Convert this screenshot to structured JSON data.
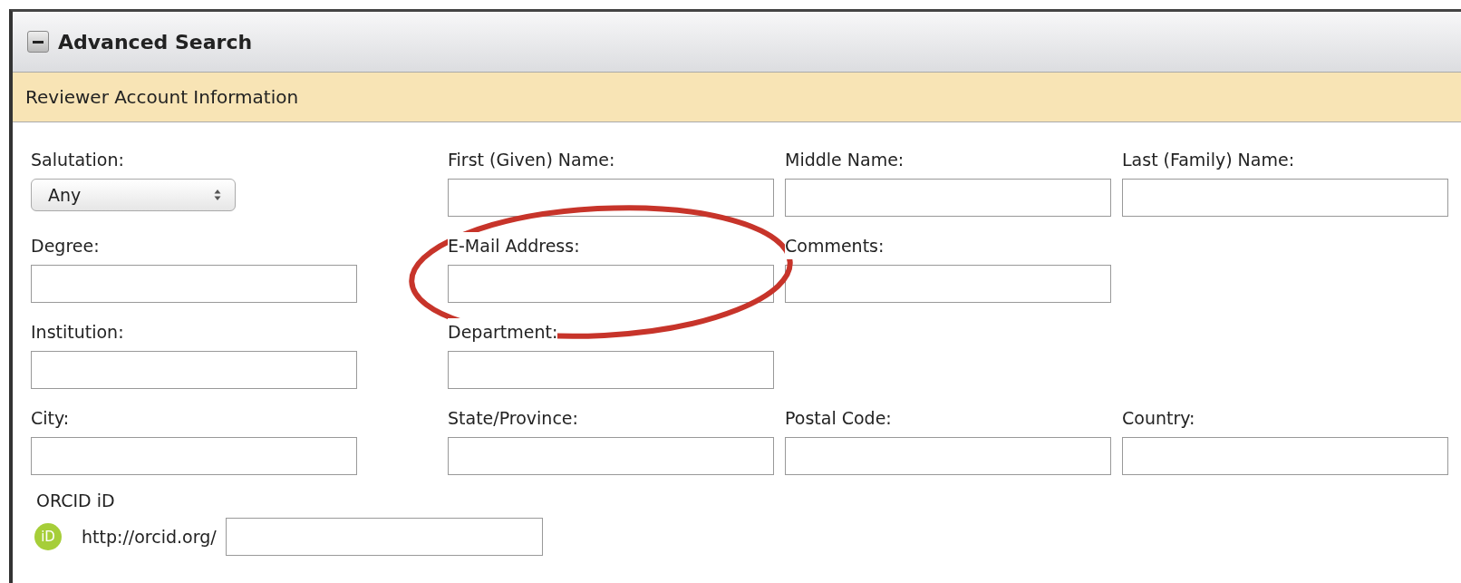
{
  "panel": {
    "title": "Advanced Search",
    "expanded": true
  },
  "section": {
    "title": "Reviewer Account Information"
  },
  "rows": [
    [
      {
        "kind": "select",
        "label": "Salutation:",
        "value": "Any"
      },
      {
        "kind": "text",
        "label": "First (Given) Name:"
      },
      {
        "kind": "text",
        "label": "Middle Name:"
      },
      {
        "kind": "text",
        "label": "Last (Family) Name:"
      }
    ],
    [
      {
        "kind": "text",
        "label": "Degree:"
      },
      {
        "kind": "text",
        "label": "E-Mail Address:"
      },
      {
        "kind": "text",
        "label": "Comments:"
      }
    ],
    [
      {
        "kind": "text",
        "label": "Institution:"
      },
      {
        "kind": "text",
        "label": "Department:"
      }
    ],
    [
      {
        "kind": "text",
        "label": "City:"
      },
      {
        "kind": "text",
        "label": "State/Province:"
      },
      {
        "kind": "text",
        "label": "Postal Code:"
      },
      {
        "kind": "text",
        "label": "Country:"
      }
    ]
  ],
  "orcid": {
    "label": "ORCID iD",
    "icon_text": "iD",
    "prefix": "http://orcid.org/"
  }
}
